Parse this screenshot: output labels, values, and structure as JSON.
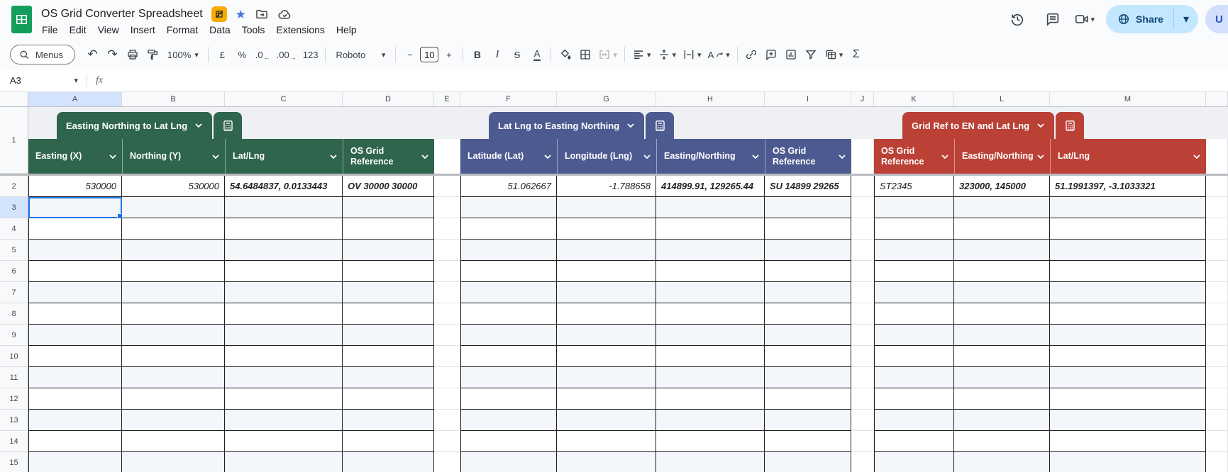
{
  "app": {
    "title": "OS Grid Converter Spreadsheet",
    "menus": [
      "File",
      "Edit",
      "View",
      "Insert",
      "Format",
      "Data",
      "Tools",
      "Extensions",
      "Help"
    ],
    "share": {
      "label": "Share"
    },
    "account": {
      "label": "U"
    }
  },
  "toolbar": {
    "menus_search_label": "Menus",
    "zoom": "100%",
    "currency": "£",
    "percent": "%",
    "dec_decimal": ".0",
    "inc_decimal": ".00",
    "number_format": "123",
    "font": "Roboto",
    "font_size": "10",
    "font_size_decrease": "−",
    "font_size_increase": "+",
    "bold": "B",
    "italic": "I",
    "strikethrough": "S",
    "text_color": "A",
    "rotate": "A",
    "functions": "Σ"
  },
  "formula_bar": {
    "name_box": "A3",
    "fx_label": "fx",
    "formula_value": ""
  },
  "grid": {
    "column_letters": [
      "A",
      "B",
      "C",
      "D",
      "E",
      "F",
      "G",
      "H",
      "I",
      "J",
      "K",
      "L",
      "M",
      ""
    ],
    "row_numbers": [
      "1",
      "2",
      "3",
      "4",
      "5",
      "6",
      "7",
      "8",
      "9",
      "10",
      "11",
      "12",
      "13",
      "14",
      "15"
    ],
    "selected_cell": "A3",
    "banding_color": "#f3f6fa",
    "selection_color": "#1a73e8",
    "header_highlight_color": "#d3e3fd"
  },
  "tables": [
    {
      "name": "Easting Northing to Lat Lng",
      "color": "#2F654D",
      "start_col": "A",
      "columns": [
        {
          "label": "Easting (X)",
          "row2": "530000",
          "align": "right",
          "bold": false
        },
        {
          "label": "Northing (Y)",
          "row2": "530000",
          "align": "right",
          "bold": false
        },
        {
          "label": "Lat/Lng",
          "row2": "54.6484837, 0.0133443",
          "align": "left",
          "bold": true
        },
        {
          "label": "OS Grid Reference",
          "row2": "OV 30000 30000",
          "align": "left",
          "bold": true
        }
      ]
    },
    {
      "name": "Lat Lng to Easting Northing",
      "color": "#4D5A90",
      "start_col": "F",
      "columns": [
        {
          "label": "Latitude (Lat)",
          "row2": "51.062667",
          "align": "right",
          "bold": false
        },
        {
          "label": "Longitude (Lng)",
          "row2": "-1.788658",
          "align": "right",
          "bold": false
        },
        {
          "label": "Easting/Northing",
          "row2": "414899.91, 129265.44",
          "align": "left",
          "bold": true
        },
        {
          "label": "OS Grid Reference",
          "row2": "SU 14899 29265",
          "align": "left",
          "bold": true
        }
      ]
    },
    {
      "name": "Grid Ref to EN and Lat Lng",
      "color": "#BB4136",
      "start_col": "K",
      "columns": [
        {
          "label": "OS Grid Reference",
          "row2": "ST2345",
          "align": "left",
          "bold": false
        },
        {
          "label": "Easting/Northing",
          "row2": "323000, 145000",
          "align": "left",
          "bold": true
        },
        {
          "label": "Lat/Lng",
          "row2": "51.1991397, -3.1033321",
          "align": "left",
          "bold": true
        }
      ]
    }
  ]
}
